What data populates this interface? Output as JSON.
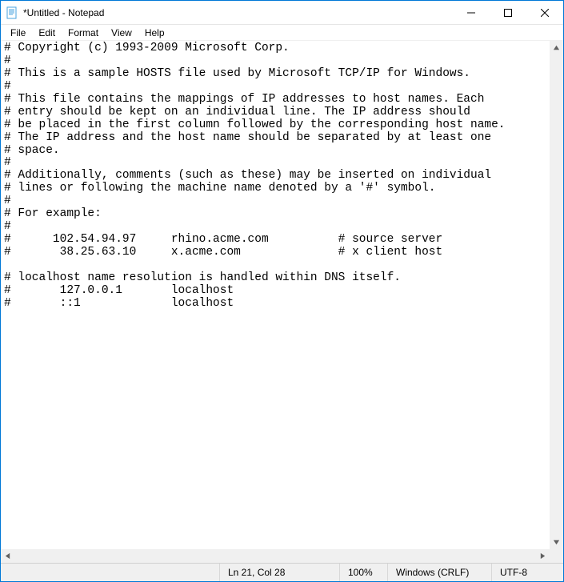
{
  "window": {
    "title": "*Untitled - Notepad"
  },
  "menu": {
    "file": "File",
    "edit": "Edit",
    "format": "Format",
    "view": "View",
    "help": "Help"
  },
  "editor": {
    "content": "# Copyright (c) 1993-2009 Microsoft Corp.\n#\n# This is a sample HOSTS file used by Microsoft TCP/IP for Windows.\n#\n# This file contains the mappings of IP addresses to host names. Each\n# entry should be kept on an individual line. The IP address should\n# be placed in the first column followed by the corresponding host name.\n# The IP address and the host name should be separated by at least one\n# space.\n#\n# Additionally, comments (such as these) may be inserted on individual\n# lines or following the machine name denoted by a '#' symbol.\n#\n# For example:\n#\n#      102.54.94.97     rhino.acme.com          # source server\n#       38.25.63.10     x.acme.com              # x client host\n\n# localhost name resolution is handled within DNS itself.\n#       127.0.0.1       localhost\n#       ::1             localhost"
  },
  "status": {
    "position": "Ln 21, Col 28",
    "zoom": "100%",
    "line_ending": "Windows (CRLF)",
    "encoding": "UTF-8"
  }
}
